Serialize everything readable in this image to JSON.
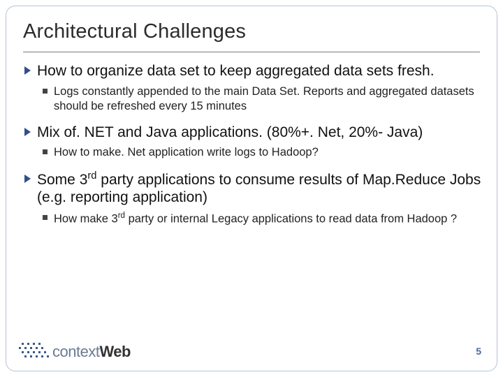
{
  "slide": {
    "title": "Architectural Challenges",
    "page_number": "5",
    "bullets": [
      {
        "text": "How to organize data set to keep aggregated data sets fresh.",
        "sub": [
          "Logs constantly appended to the main Data Set. Reports and aggregated datasets should be refreshed every 15 minutes"
        ]
      },
      {
        "text": "Mix of. NET and Java applications. (80%+. Net, 20%- Java)",
        "sub": [
          "How to make. Net application write logs to Hadoop?"
        ]
      },
      {
        "text_html": "Some 3<sup>rd</sup> party applications to consume results of Map.Reduce Jobs (e.g. reporting application)",
        "sub_html": [
          "How make 3<sup>rd</sup> party or internal Legacy applications to read data from Hadoop ?"
        ]
      }
    ],
    "logo": {
      "text_left": "context",
      "text_right": "Web"
    }
  }
}
